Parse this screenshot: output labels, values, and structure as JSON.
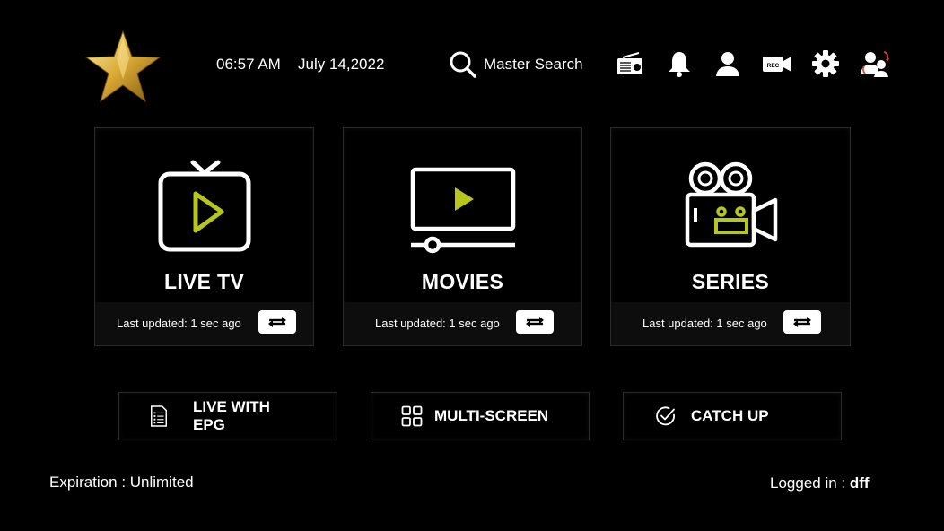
{
  "header": {
    "time": "06:57 AM",
    "date": "July 14,2022",
    "search_label": "Master Search",
    "icons": [
      "radio-icon",
      "bell-icon",
      "user-icon",
      "rec-icon",
      "gear-icon",
      "switch-user-icon"
    ],
    "rec_text": "REC"
  },
  "cards": [
    {
      "title": "LIVE TV",
      "updated": "Last updated: 1 sec ago"
    },
    {
      "title": "MOVIES",
      "updated": "Last updated: 1 sec ago"
    },
    {
      "title": "SERIES",
      "updated": "Last updated: 1 sec ago"
    }
  ],
  "buttons": {
    "epg_line1": "LIVE WITH",
    "epg_line2": "EPG",
    "multiscreen": "MULTI-SCREEN",
    "catchup": "CATCH UP"
  },
  "footer": {
    "expiration": "Expiration : Unlimited",
    "logged_prefix": "Logged in : ",
    "logged_user": "dff"
  },
  "colors": {
    "accent": "#b7c61a",
    "background": "#000000",
    "gold": "#d9a933"
  }
}
